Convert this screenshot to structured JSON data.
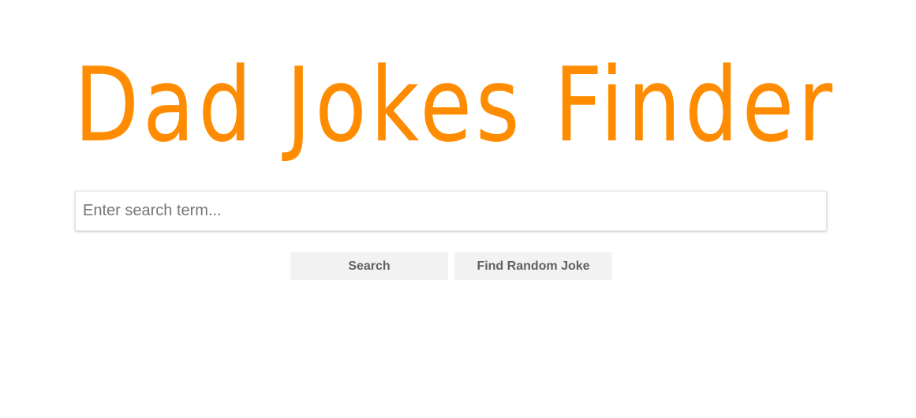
{
  "header": {
    "title": "Dad Jokes Finder"
  },
  "search": {
    "placeholder": "Enter search term...",
    "value": ""
  },
  "buttons": {
    "search_label": "Search",
    "random_label": "Find Random Joke"
  },
  "colors": {
    "title": "#FF8C00",
    "button_bg": "#F2F2F2",
    "button_text": "#616161"
  }
}
